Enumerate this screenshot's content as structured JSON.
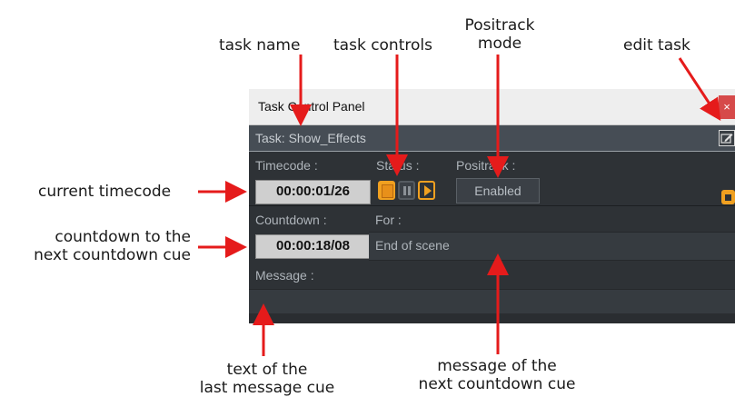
{
  "annotations": {
    "task_name": "task name",
    "task_controls": "task controls",
    "positrack_mode_line1": "Positrack",
    "positrack_mode_line2": "mode",
    "edit_task": "edit task",
    "current_timecode": "current timecode",
    "countdown_line1": "countdown to the",
    "countdown_line2": "next countdown cue",
    "message_text_line1": "text of the",
    "message_text_line2": "last message cue",
    "message_next_line1": "message of the",
    "message_next_line2": "next countdown cue"
  },
  "window": {
    "title": "Task Control Panel",
    "close_label": "×"
  },
  "task": {
    "label": "Task:",
    "name": "Show_Effects"
  },
  "timecode": {
    "label": "Timecode :",
    "value": "00:00:01/26"
  },
  "status": {
    "label": "Status :"
  },
  "positrack": {
    "label": "Positrack :",
    "value": "Enabled"
  },
  "countdown": {
    "label": "Countdown :",
    "value": "00:00:18/08"
  },
  "for": {
    "label": "For :",
    "value": "End of scene"
  },
  "message": {
    "label": "Message :",
    "value": ""
  },
  "colors": {
    "accent": "#f0a020",
    "arrow": "#e51b1b",
    "panel": "#2e3236"
  }
}
